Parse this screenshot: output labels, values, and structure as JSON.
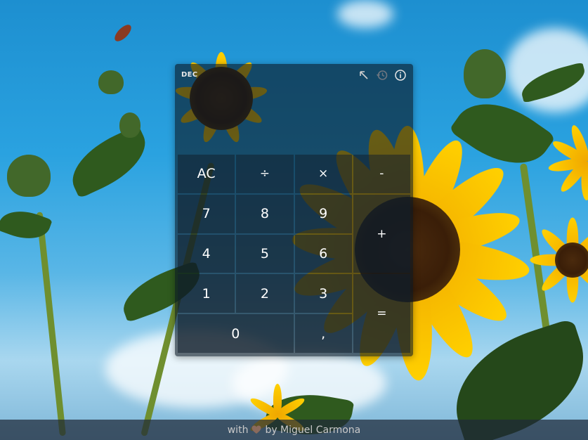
{
  "calculator": {
    "mode": "DEC",
    "display": "",
    "icons": [
      "collapse-arrow-icon",
      "history-icon",
      "info-icon"
    ],
    "keys": {
      "clear": "AC",
      "divide": "÷",
      "multiply": "×",
      "minus": "-",
      "seven": "7",
      "eight": "8",
      "nine": "9",
      "plus": "+",
      "four": "4",
      "five": "5",
      "six": "6",
      "one": "1",
      "two": "2",
      "three": "3",
      "equals": "=",
      "zero": "0",
      "decimal": ","
    }
  },
  "credit": {
    "prefix": "with",
    "heart_color": "#8a6a5c",
    "suffix": "by Miguel Carmona"
  }
}
